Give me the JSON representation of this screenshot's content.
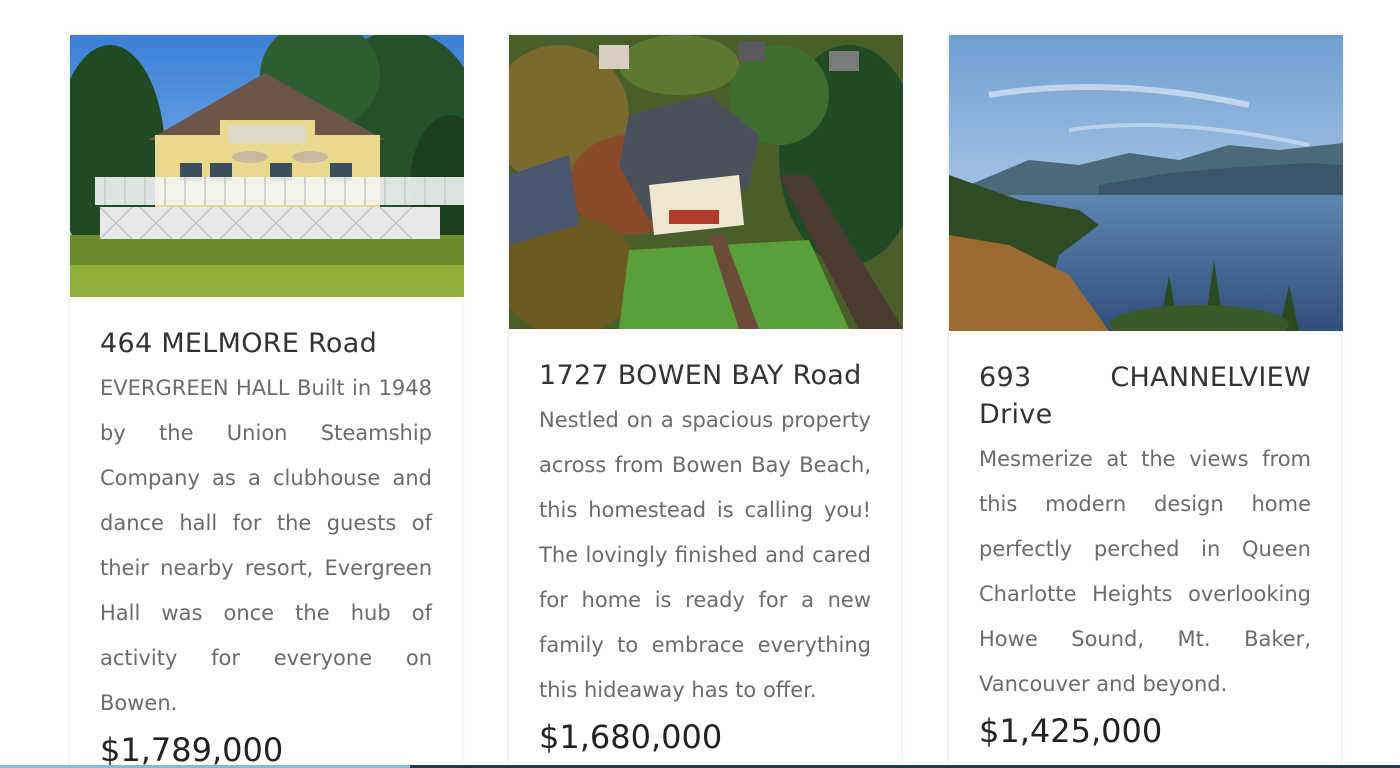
{
  "listings": [
    {
      "title": "464 MELMORE Road",
      "description": "EVERGREEN HALL Built in 1948 by the Union Steamship Company as a clubhouse and dance hall for the guests of their nearby resort, Evergreen Hall was once the hub of activity for everyone on Bowen.",
      "price": "$1,789,000",
      "photo_icon": "yellow-house-photo"
    },
    {
      "title": "1727 BOWEN BAY Road",
      "description": "Nestled on a spacious property across from Bowen Bay Beach, this homestead is calling you! The lovingly finished and cared for home is ready for a new family to embrace everything this hideaway has to offer.",
      "price": "$1,680,000",
      "photo_icon": "aerial-house-photo"
    },
    {
      "title": "693 CHANNELVIEW Drive",
      "description": "Mesmerize at the views from this modern design home perfectly perched in Queen Charlotte Heights overlooking Howe Sound, Mt. Baker, Vancouver and beyond.",
      "price": "$1,425,000",
      "photo_icon": "ocean-view-photo"
    }
  ],
  "colors": {
    "title": "#333333",
    "description": "#6b6b6b",
    "price": "#222222",
    "bottom_bar_light": "#7fc0d4",
    "bottom_bar_dark": "#1e3d4a"
  }
}
